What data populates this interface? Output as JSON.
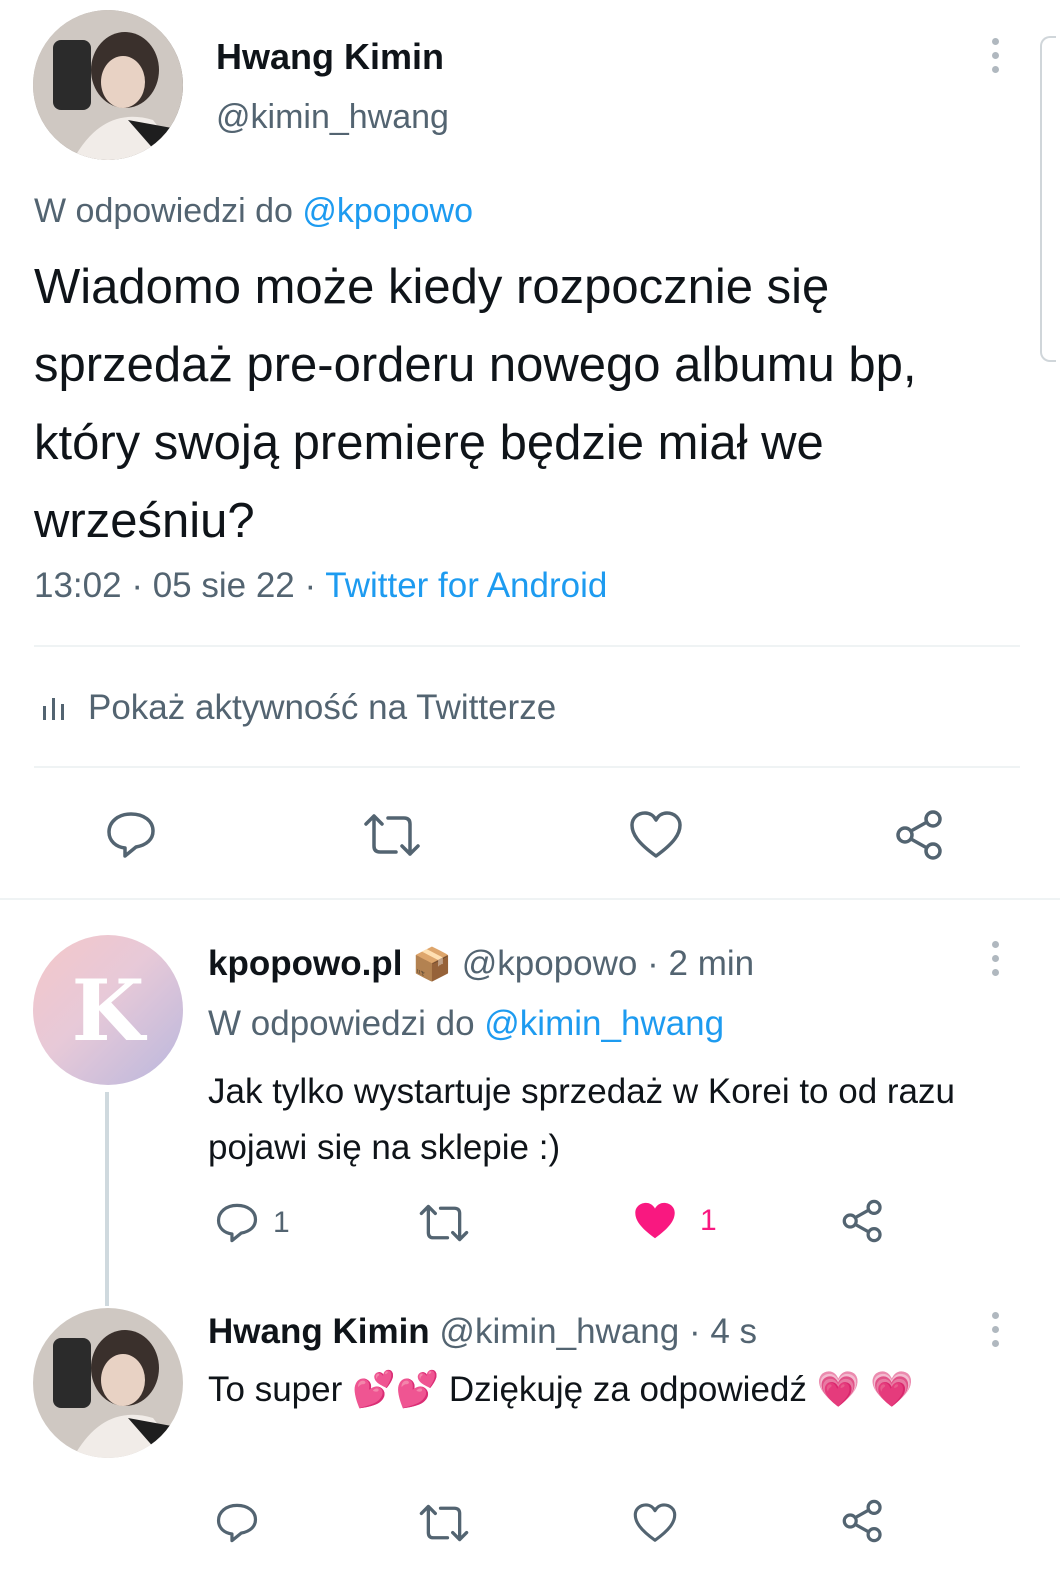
{
  "main_tweet": {
    "author_name": "Hwang Kimin",
    "author_handle": "@kimin_hwang",
    "reply_prefix": "W odpowiedzi do",
    "reply_to": "@kpopowo",
    "text": "Wiadomo może kiedy rozpocznie się sprzedaż pre-orderu nowego albumu bp, który swoją premierę będzie miał we wrześniu?",
    "time": "13:02",
    "date": "05 sie 22",
    "separator": "·",
    "source": "Twitter for Android",
    "activity_label": "Pokaż aktywność na Twitterze",
    "icons": [
      "reply-icon",
      "retweet-icon",
      "like-icon",
      "share-icon",
      "more-icon",
      "analytics-icon"
    ]
  },
  "replies": [
    {
      "author_name": "kpopowo.pl",
      "badge_emoji": "📦",
      "author_handle": "@kpopowo",
      "separator": "·",
      "time": "2 min",
      "reply_prefix": "W odpowiedzi do",
      "reply_to": "@kimin_hwang",
      "text": "Jak tylko wystartuje sprzedaż w Korei to od razu pojawi się na sklepie :)",
      "reply_count": "1",
      "like_count": "1",
      "liked": true,
      "avatar_letter": "K"
    },
    {
      "author_name": "Hwang Kimin",
      "author_handle": "@kimin_hwang",
      "separator": "·",
      "time": "4 s",
      "text_part1": "To super",
      "emoji_hearts": "💕💕",
      "text_part2": "Dziękuję za odpowiedź",
      "emoji_heart_end": "💗",
      "emoji_heart_wrap": "💗"
    }
  ],
  "colors": {
    "accent": "#1d9bf0",
    "like": "#f91880",
    "muted": "#536471",
    "text": "#0f1419",
    "divider": "#eff3f4"
  }
}
